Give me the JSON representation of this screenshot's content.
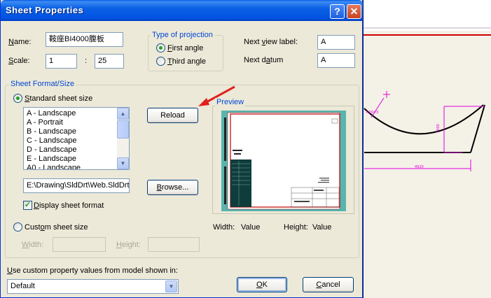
{
  "dialog": {
    "title": "Sheet Properties",
    "help_label": "?",
    "close_label": "✕"
  },
  "name": {
    "label": "Name:",
    "value": "鞍座BI4000腹板"
  },
  "scale": {
    "label": "Scale:",
    "num": "1",
    "separator": ":",
    "den": "25"
  },
  "projection": {
    "title": "Type of projection",
    "first_angle": "First angle",
    "third_angle": "Third angle",
    "selected": "First angle"
  },
  "next_view": {
    "label": "Next view label:",
    "value": "A"
  },
  "next_datum": {
    "label": "Next datum",
    "value": "A"
  },
  "format": {
    "group_title": "Sheet Format/Size",
    "standard_label": "Standard sheet size",
    "sizes": [
      "A - Landscape",
      "A - Portrait",
      "B - Landscape",
      "C - Landscape",
      "D - Landscape",
      "E - Landscape",
      "A0 - Landscape"
    ],
    "reload_label": "Reload",
    "path_value": "E:\\Drawing\\SldDrt\\Web.SldDrt",
    "browse_label": "Browse...",
    "display_format_label": "Display sheet format",
    "display_format_checked": true,
    "custom_label": "Custom sheet size",
    "width_label": "Width:",
    "height_label": "Height:"
  },
  "preview": {
    "title": "Preview",
    "width_label": "Width:",
    "width_value": "Value",
    "height_label": "Height:",
    "height_value": "Value"
  },
  "custom_property": {
    "label": "Use custom property values from model shown in:",
    "selected": "Default"
  },
  "buttons": {
    "ok": "OK",
    "cancel": "Cancel"
  },
  "colors": {
    "title_bar": "#0054e3",
    "group_title": "#0046d5",
    "preview_bg": "#5ab4ae",
    "preview_border": "#c00000",
    "annotation": "#e000e0",
    "arrow": "#e0201c"
  },
  "drawing": {
    "dim_width": "4920",
    "dim_height": "1000",
    "dim_angle": "R20=3"
  }
}
